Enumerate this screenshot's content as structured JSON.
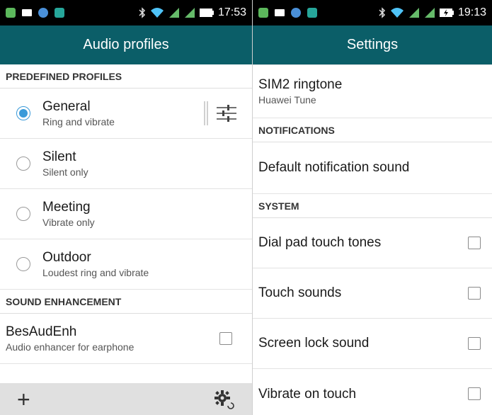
{
  "left": {
    "status_time": "17:53",
    "title": "Audio profiles",
    "predefined_header": "PREDEFINED PROFILES",
    "profiles": [
      {
        "title": "General",
        "subtitle": "Ring and vibrate",
        "checked": true
      },
      {
        "title": "Silent",
        "subtitle": "Silent only",
        "checked": false
      },
      {
        "title": "Meeting",
        "subtitle": "Vibrate only",
        "checked": false
      },
      {
        "title": "Outdoor",
        "subtitle": "Loudest ring and vibrate",
        "checked": false
      }
    ],
    "enhancement_header": "SOUND ENHANCEMENT",
    "enhancement": {
      "title": "BesAudEnh",
      "subtitle": "Audio enhancer for earphone",
      "checked": false
    },
    "bottom": {
      "add_icon": "plus-icon",
      "settings_icon": "gear-reset-icon"
    }
  },
  "right": {
    "status_time": "19:13",
    "title": "Settings",
    "sim2": {
      "title": "SIM2 ringtone",
      "subtitle": "Huawei Tune"
    },
    "notifications_header": "NOTIFICATIONS",
    "default_notification": "Default notification sound",
    "system_header": "SYSTEM",
    "system_items": [
      {
        "label": "Dial pad touch tones",
        "checked": false
      },
      {
        "label": "Touch sounds",
        "checked": false
      },
      {
        "label": "Screen lock sound",
        "checked": false
      },
      {
        "label": "Vibrate on touch",
        "checked": false
      }
    ]
  },
  "colors": {
    "titlebar": "#0b5e68",
    "radio_accent": "#3a9ad9",
    "status_bar": "#000000"
  }
}
